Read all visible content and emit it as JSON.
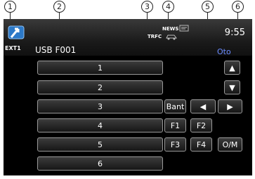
{
  "callouts": [
    "1",
    "2",
    "3",
    "4",
    "5",
    "6"
  ],
  "status": {
    "source_name": "EXT1",
    "folder": "USB F001",
    "news": "NEWS",
    "trfc": "TRFC",
    "clock": "9:55",
    "mode": "Oto"
  },
  "presets": [
    "1",
    "2",
    "3",
    "4",
    "5",
    "6"
  ],
  "controls": {
    "up": "▲",
    "down": "▼",
    "bant": "Bant",
    "left": "◀",
    "right": "▶",
    "f1": "F1",
    "f2": "F2",
    "f3": "F3",
    "f4": "F4",
    "om": "O/M"
  },
  "colors": {
    "mode_text": "#6b8cff",
    "background": "#000000",
    "button_border": "#9a9a9a"
  }
}
